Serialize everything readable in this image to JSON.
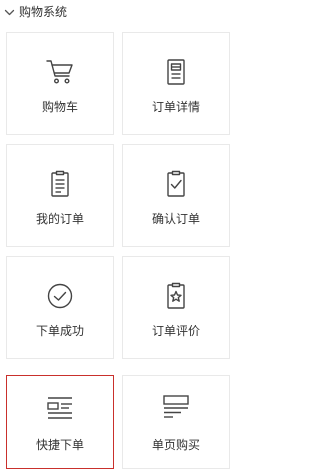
{
  "section": {
    "title": "购物系统",
    "expanded": true,
    "chevron_icon": "chevron-down-icon"
  },
  "colors": {
    "text": "#333333",
    "border": "#e9e9e9",
    "selected_border": "#c9302c",
    "icon_stroke": "#444444"
  },
  "tiles": [
    {
      "label": "购物车",
      "icon": "shopping-cart-icon",
      "selected": false
    },
    {
      "label": "订单详情",
      "icon": "order-details-icon",
      "selected": false
    },
    {
      "label": "我的订单",
      "icon": "my-orders-icon",
      "selected": false
    },
    {
      "label": "确认订单",
      "icon": "confirm-order-icon",
      "selected": false
    },
    {
      "label": "下单成功",
      "icon": "order-success-icon",
      "selected": false
    },
    {
      "label": "订单评价",
      "icon": "order-review-icon",
      "selected": false
    },
    {
      "label": "快捷下单",
      "icon": "quick-order-icon",
      "selected": true
    },
    {
      "label": "单页购买",
      "icon": "single-page-purchase-icon",
      "selected": false
    }
  ]
}
